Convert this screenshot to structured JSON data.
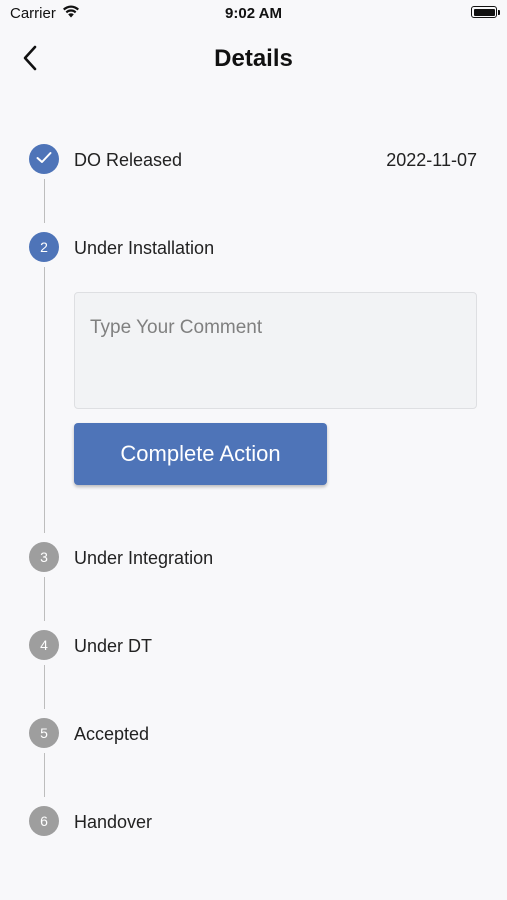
{
  "status_bar": {
    "carrier": "Carrier",
    "time": "9:02 AM",
    "wifi_icon": "wifi-icon",
    "battery_icon": "battery-icon"
  },
  "nav": {
    "title": "Details",
    "back_icon": "chevron-left-icon"
  },
  "colors": {
    "active": "#4e74b8",
    "inactive": "#9e9e9e",
    "connector": "#bdbdbd",
    "background": "#f8f8fa"
  },
  "steps": [
    {
      "number": "1",
      "label": "DO Released",
      "date": "2022-11-07",
      "state": "completed",
      "icon": "check-icon"
    },
    {
      "number": "2",
      "label": "Under Installation",
      "state": "current"
    },
    {
      "number": "3",
      "label": "Under Integration",
      "state": "pending"
    },
    {
      "number": "4",
      "label": "Under DT",
      "state": "pending"
    },
    {
      "number": "5",
      "label": "Accepted",
      "state": "pending"
    },
    {
      "number": "6",
      "label": "Handover",
      "state": "pending"
    }
  ],
  "comment": {
    "placeholder": "Type Your Comment",
    "value": ""
  },
  "action": {
    "button_label": "Complete Action"
  }
}
